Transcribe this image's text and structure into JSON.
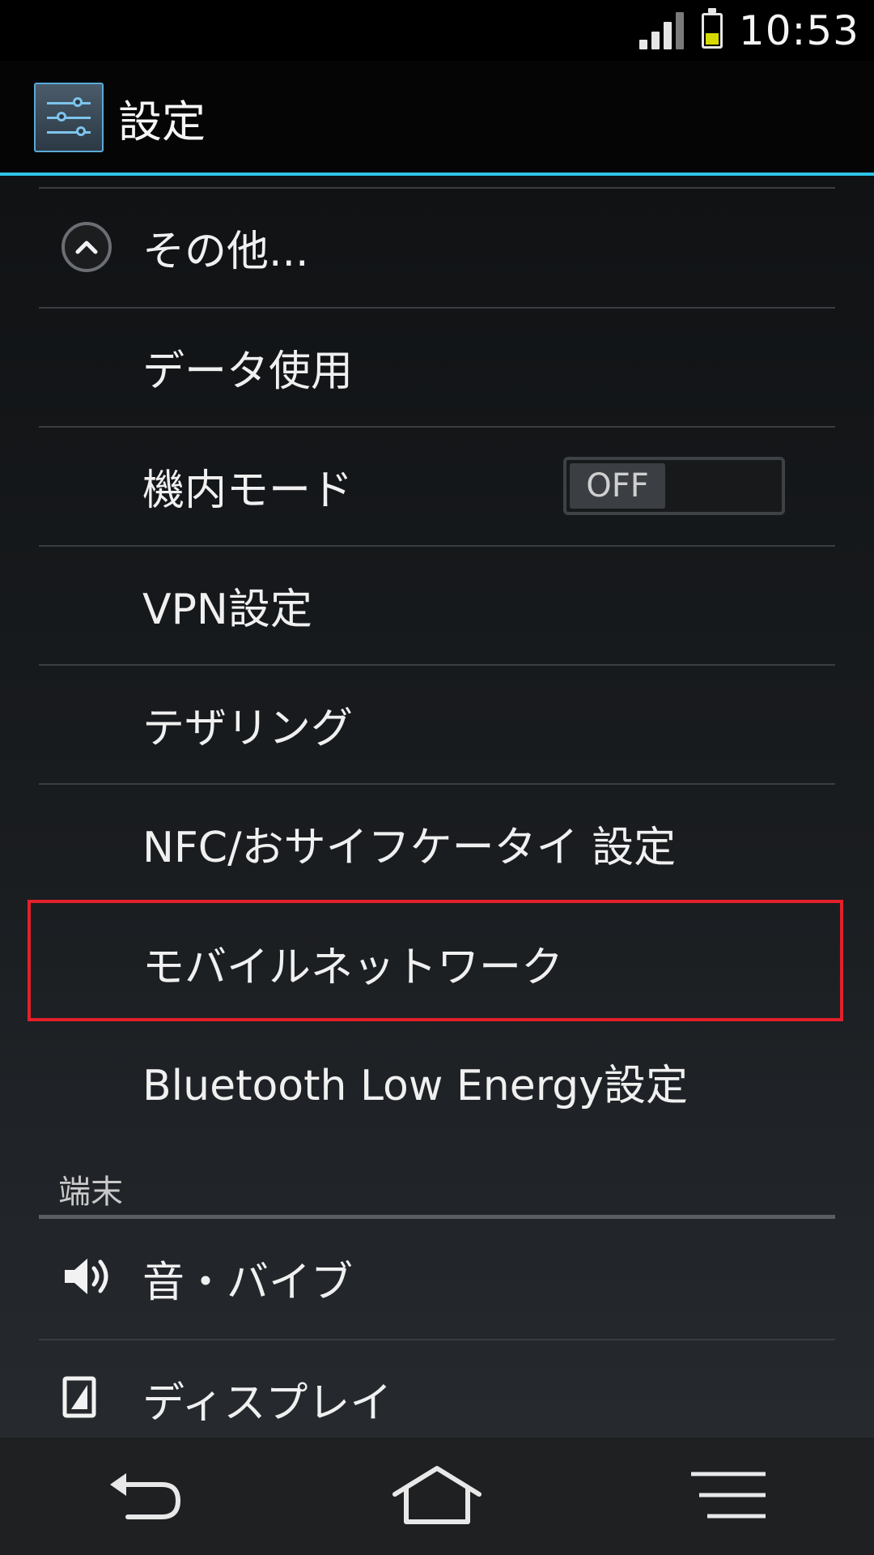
{
  "status_bar": {
    "time": "10:53",
    "signal_icon": "signal-icon",
    "battery_icon": "battery-icon",
    "battery_color": "#d6d900"
  },
  "action_bar": {
    "title": "設定",
    "icon": "settings-sliders-icon",
    "accent_color": "#2ec3e6"
  },
  "list": {
    "items": [
      {
        "label": "その他...",
        "icon": "collapse-up-icon"
      },
      {
        "label": "データ使用"
      },
      {
        "label": "機内モード",
        "toggle": {
          "state": "OFF"
        }
      },
      {
        "label": "VPN設定"
      },
      {
        "label": "テザリング"
      },
      {
        "label": "NFC/おサイフケータイ 設定"
      },
      {
        "label": "モバイルネットワーク",
        "highlighted": true
      },
      {
        "label": "Bluetooth Low Energy設定"
      }
    ],
    "section_header": "端末",
    "device_items": [
      {
        "label": "音・バイブ",
        "icon": "speaker-icon"
      },
      {
        "label": "ディスプレイ",
        "icon": "display-icon"
      }
    ],
    "highlight_color": "#e3202a"
  },
  "nav_bar": {
    "back_icon": "back-icon",
    "home_icon": "home-icon",
    "menu_icon": "menu-icon"
  }
}
